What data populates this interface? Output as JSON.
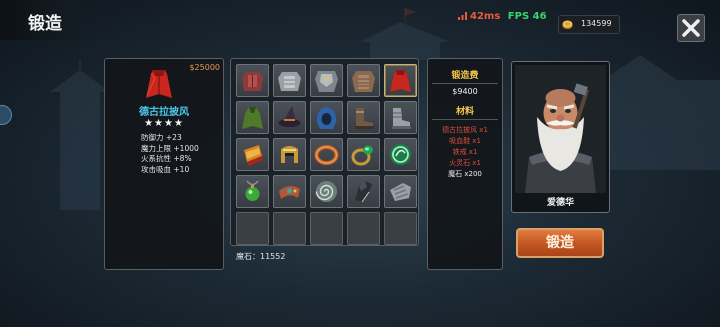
{
  "header": {
    "title": "锻造"
  },
  "status": {
    "ping": "42ms",
    "fps": "FPS 46"
  },
  "currency": {
    "gold": "134599",
    "icon": "gold-coin-icon"
  },
  "item_info": {
    "price": "$25000",
    "name": "德古拉披风",
    "stars": "★★★★",
    "stats": [
      "防御力 +23",
      "魔力上限 +1000",
      "火系抗性 +8%",
      "攻击吸血 +10"
    ]
  },
  "inventory": {
    "items": [
      {
        "icon": "red-chest-armor-icon",
        "selected": false
      },
      {
        "icon": "steel-chest-armor-icon",
        "selected": false
      },
      {
        "icon": "plate-armor-icon",
        "selected": false
      },
      {
        "icon": "leather-armor-icon",
        "selected": false
      },
      {
        "icon": "red-cape-icon",
        "selected": true
      },
      {
        "icon": "green-cloak-icon",
        "selected": false
      },
      {
        "icon": "witch-hat-icon",
        "selected": false
      },
      {
        "icon": "blue-hood-icon",
        "selected": false
      },
      {
        "icon": "leather-boots-icon",
        "selected": false
      },
      {
        "icon": "steel-boots-icon",
        "selected": false
      },
      {
        "icon": "gold-bracer-icon",
        "selected": false
      },
      {
        "icon": "gold-helmet-icon",
        "selected": false
      },
      {
        "icon": "bronze-ring-icon",
        "selected": false
      },
      {
        "icon": "emerald-ring-icon",
        "selected": false
      },
      {
        "icon": "green-dragon-amulet-icon",
        "selected": false
      },
      {
        "icon": "green-pendant-icon",
        "selected": false
      },
      {
        "icon": "leather-bracer-icon",
        "selected": false
      },
      {
        "icon": "spiral-charm-icon",
        "selected": false
      },
      {
        "icon": "dark-gauntlet-icon",
        "selected": false
      },
      {
        "icon": "steel-gauntlet-icon",
        "selected": false
      },
      {
        "icon": "",
        "selected": false
      },
      {
        "icon": "",
        "selected": false
      },
      {
        "icon": "",
        "selected": false
      },
      {
        "icon": "",
        "selected": false
      },
      {
        "icon": "",
        "selected": false
      }
    ],
    "stone_count": "魔石：11552"
  },
  "cost": {
    "fee_title": "锻造费",
    "fee_value": "$9400",
    "materials_title": "材料",
    "materials": [
      {
        "text": "德古拉披风 x1",
        "enough": false
      },
      {
        "text": "吸血鞋 x1",
        "enough": false
      },
      {
        "text": "铁戒 x1",
        "enough": false
      },
      {
        "text": "火灵石 x1",
        "enough": false
      },
      {
        "text": "魔石 x200",
        "enough": true
      }
    ]
  },
  "npc": {
    "name": "爱德华"
  },
  "forge_button": {
    "label": "锻造"
  },
  "colors": {
    "accent_orange": "#c2551f",
    "item_name_cyan": "#4bc7e6",
    "material_missing_red": "#e24a3a",
    "section_title_gold": "#f2c74a",
    "fps_green": "#36d46a"
  }
}
